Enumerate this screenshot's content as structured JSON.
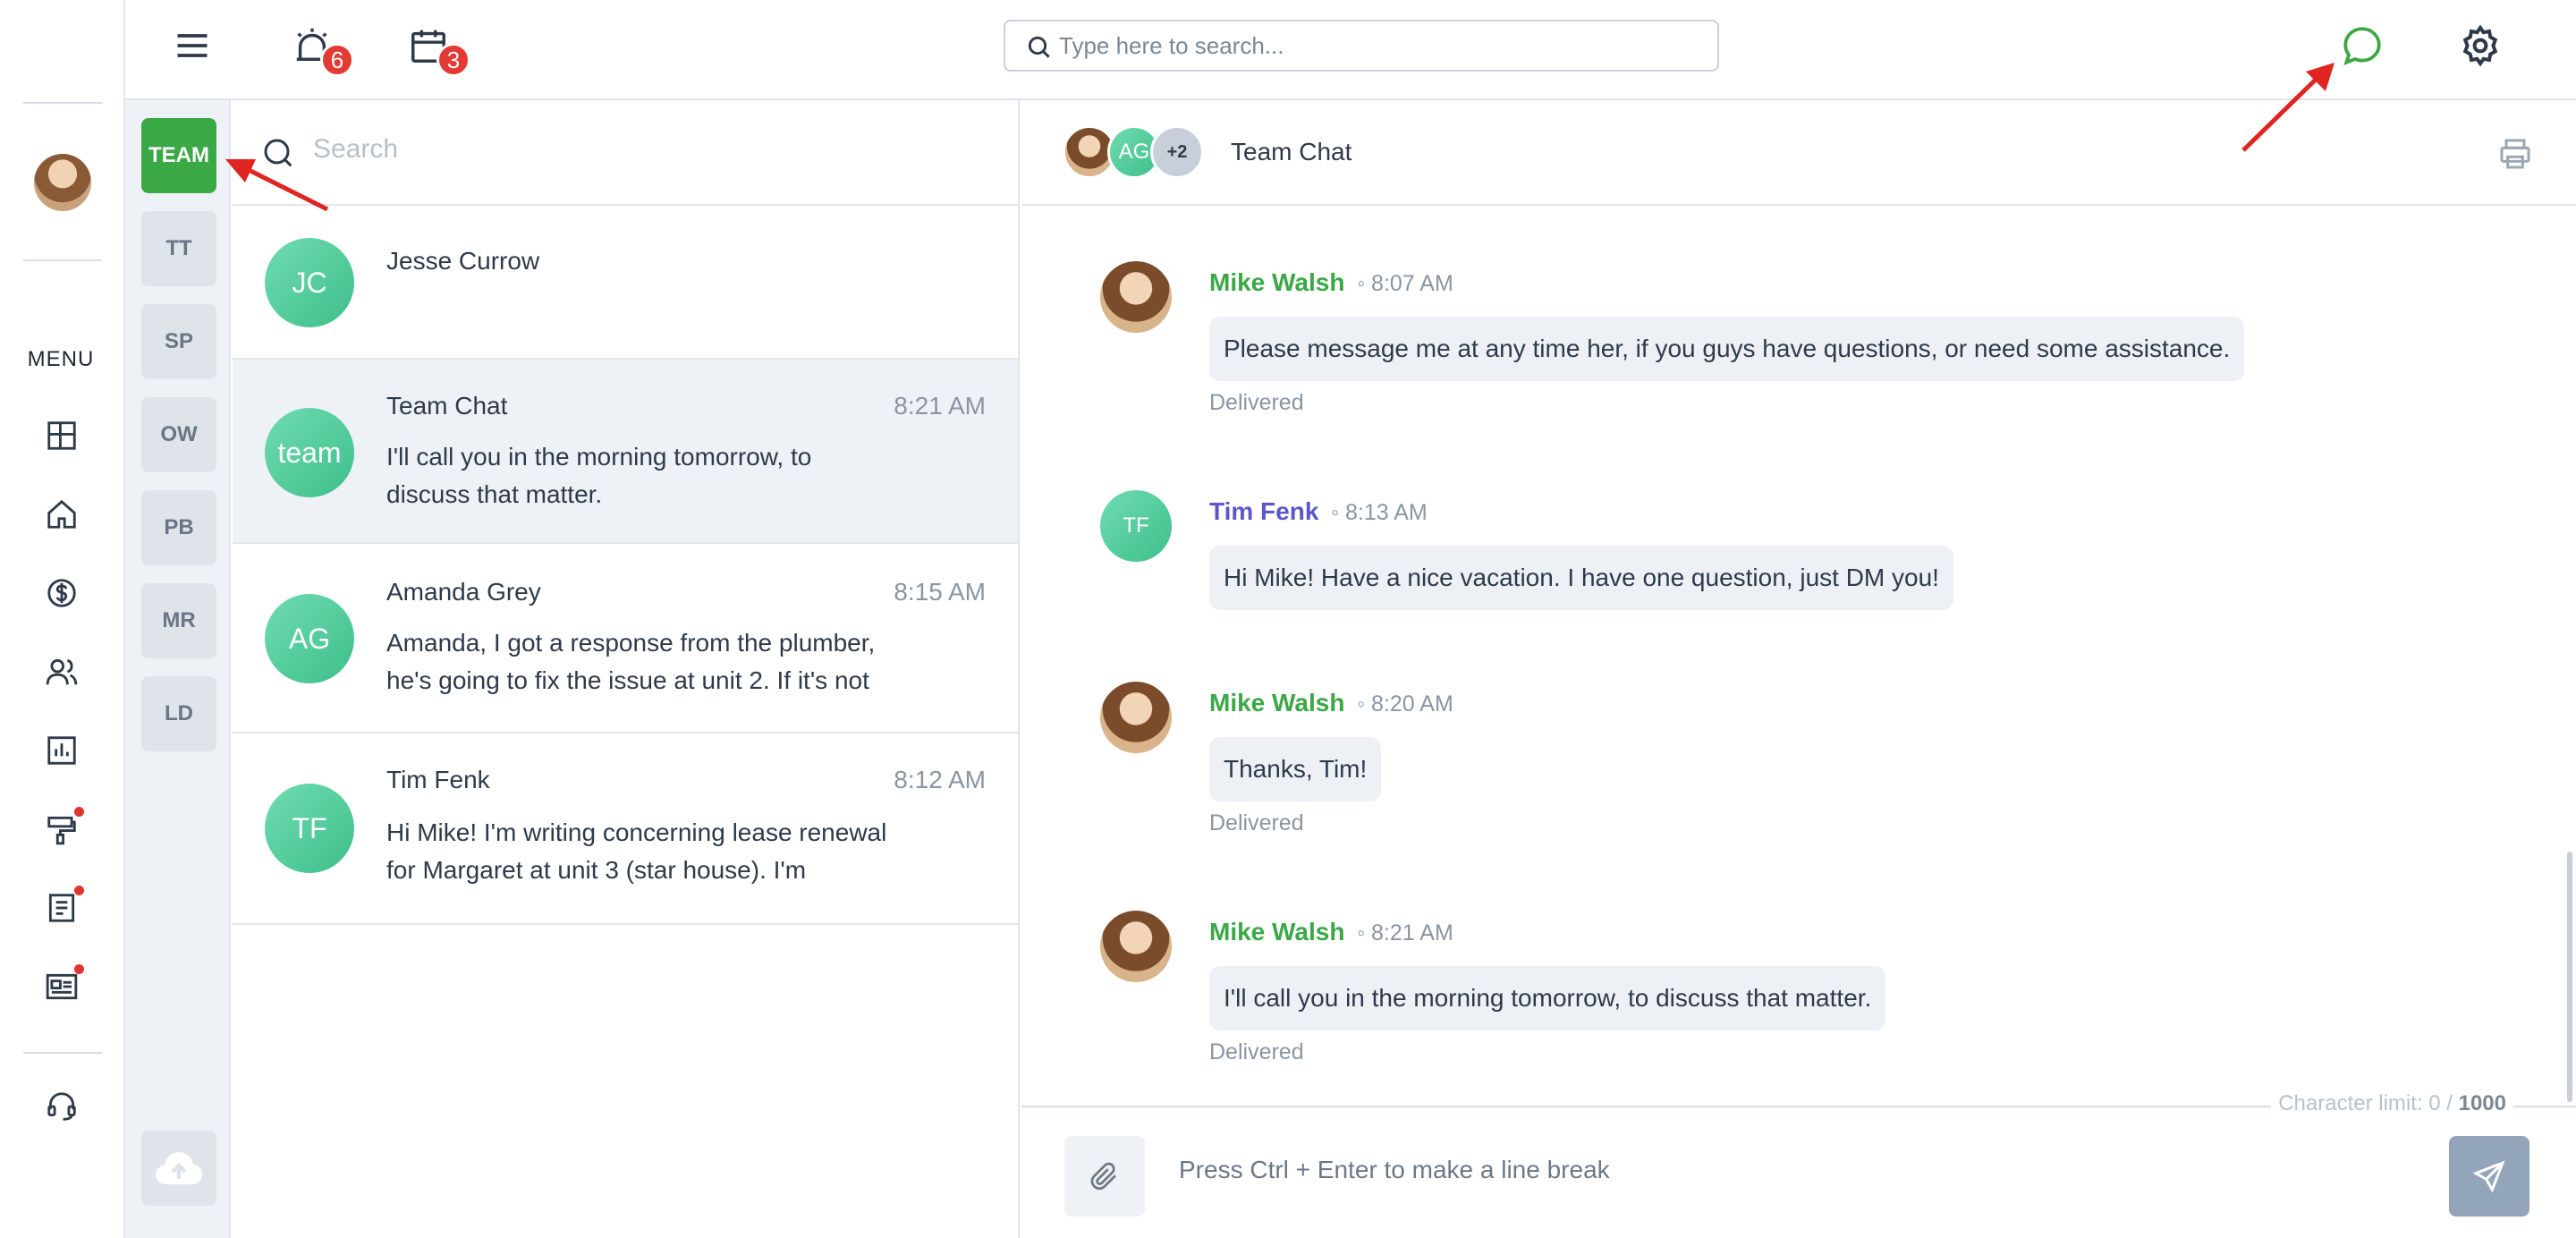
{
  "header": {
    "search_placeholder": "Type here to search...",
    "alarm_badge": "6",
    "calendar_badge": "3"
  },
  "leftnav": {
    "menu_label": "MENU"
  },
  "groups": [
    "TEAM",
    "TT",
    "SP",
    "OW",
    "PB",
    "MR",
    "LD"
  ],
  "convlist": {
    "search_placeholder": "Search",
    "items": [
      {
        "initials": "JC",
        "name": "Jesse Currow",
        "time": "",
        "message": ""
      },
      {
        "initials": "team",
        "name": "Team Chat",
        "time": "8:21 AM",
        "message": "I'll call you in the morning tomorrow, to discuss that matter."
      },
      {
        "initials": "AG",
        "name": "Amanda Grey",
        "time": "8:15 AM",
        "message": "Amanda, I got a response from the plumber, he's going to fix the issue at unit 2. If it's not"
      },
      {
        "initials": "TF",
        "name": "Tim Fenk",
        "time": "8:12 AM",
        "message": "Hi Mike! I'm writing concerning lease renewal for Margaret at unit 3 (star house). I'm"
      }
    ]
  },
  "chat": {
    "title": "Team Chat",
    "stack_ag": "AG",
    "stack_more": "+2",
    "messages": [
      {
        "sender": "Mike Walsh",
        "time": "◦ 8:07 AM",
        "text": "Please message me at any time her, if you guys have questions, or need some assistance.",
        "status": "Delivered"
      },
      {
        "sender": "Tim Fenk",
        "initials": "TF",
        "time": "◦ 8:13 AM",
        "text": "Hi Mike! Have a nice vacation. I have one question, just DM you!",
        "status": ""
      },
      {
        "sender": "Mike Walsh",
        "time": "◦ 8:20 AM",
        "text": "Thanks, Tim!",
        "status": "Delivered"
      },
      {
        "sender": "Mike Walsh",
        "time": "◦ 8:21 AM",
        "text": "I'll call you in the morning tomorrow, to discuss that matter.",
        "status": "Delivered"
      }
    ],
    "char_limit_label": "Character limit: 0 / ",
    "char_limit_max": "1000",
    "composer_placeholder": "Press Ctrl + Enter to make a line break"
  },
  "colors": {
    "accent_green": "#3aa845",
    "badge_red": "#e33a33",
    "purple_name": "#5b57c9"
  }
}
